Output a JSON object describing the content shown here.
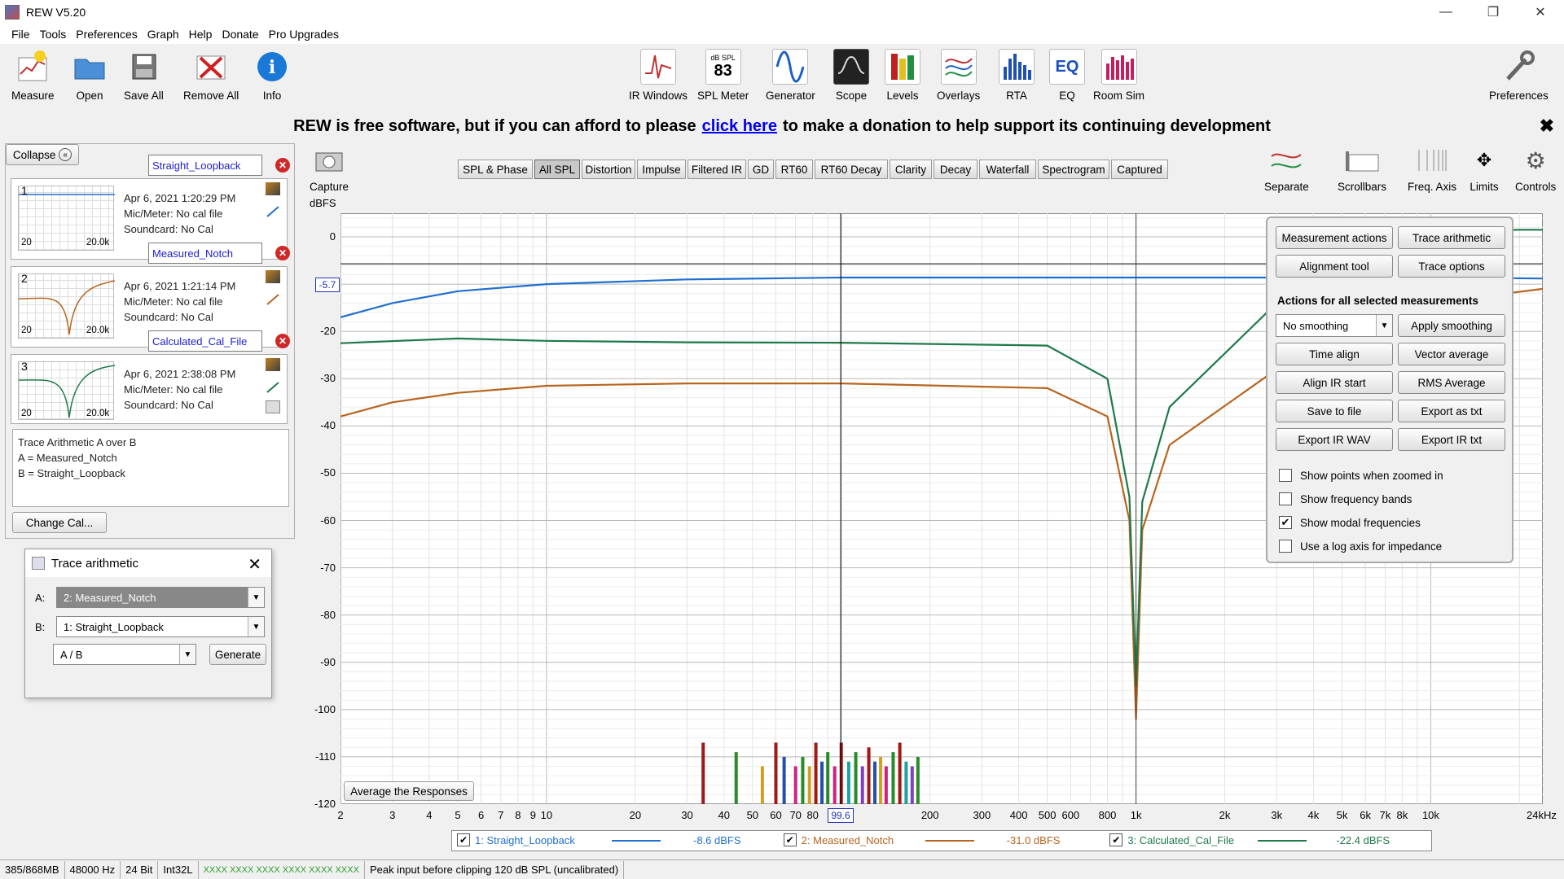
{
  "window": {
    "title": "REW V5.20"
  },
  "menu": [
    "File",
    "Tools",
    "Preferences",
    "Graph",
    "Help",
    "Donate",
    "Pro Upgrades"
  ],
  "toolbar": {
    "left": [
      "Measure",
      "Open",
      "Save All",
      "Remove All",
      "Info"
    ],
    "center": [
      "IR Windows",
      "SPL Meter",
      "Generator",
      "Scope",
      "Levels",
      "Overlays",
      "RTA",
      "EQ",
      "Room Sim"
    ],
    "right": "Preferences",
    "spl_badge_top": "dB SPL",
    "spl_badge_value": "83",
    "eq_badge": "EQ"
  },
  "banner": {
    "before": "REW is free software, but if you can afford to please",
    "link": "click here",
    "after": "to make a donation to help support its continuing development"
  },
  "left_panel": {
    "collapse": "Collapse",
    "measurements": [
      {
        "num": "1",
        "name": "Straight_Loopback",
        "date": "Apr 6, 2021 1:20:29 PM",
        "mic": "Mic/Meter: No cal file",
        "card": "Soundcard: No Cal",
        "tl_left": "20",
        "tl_right": "20.0k"
      },
      {
        "num": "2",
        "name": "Measured_Notch",
        "date": "Apr 6, 2021 1:21:14 PM",
        "mic": "Mic/Meter: No cal file",
        "card": "Soundcard: No Cal",
        "tl_left": "20",
        "tl_right": "20.0k"
      },
      {
        "num": "3",
        "name": "Calculated_Cal_File",
        "date": "Apr 6, 2021 2:38:08 PM",
        "mic": "Mic/Meter: No cal file",
        "card": "Soundcard: No Cal",
        "tl_left": "20",
        "tl_right": "20.0k"
      }
    ],
    "notes": [
      "Trace Arithmetic A over B",
      "A = Measured_Notch",
      "B = Straight_Loopback"
    ],
    "change_cal": "Change Cal..."
  },
  "trace_dialog": {
    "title": "Trace arithmetic",
    "a_label": "A:",
    "a_value": "2: Measured_Notch",
    "b_label": "B:",
    "b_value": "1: Straight_Loopback",
    "op_value": "A / B",
    "generate": "Generate"
  },
  "graph": {
    "capture": "Capture",
    "tabs": [
      "SPL & Phase",
      "All SPL",
      "Distortion",
      "Impulse",
      "Filtered IR",
      "GD",
      "RT60",
      "RT60 Decay",
      "Clarity",
      "Decay",
      "Waterfall",
      "Spectrogram",
      "Captured"
    ],
    "selected_tab": "All SPL",
    "right_icons": [
      "Separate",
      "Scrollbars",
      "Freq. Axis",
      "Limits",
      "Controls"
    ],
    "yunit": "dBFS",
    "cursor_y": "-5.7",
    "cursor_x": "99.6",
    "avg_button": "Average the Responses",
    "x_end_label": "24kHz"
  },
  "actions_panel": {
    "buttons_top": [
      "Measurement actions",
      "Trace arithmetic",
      "Alignment tool",
      "Trace options"
    ],
    "heading": "Actions for all selected measurements",
    "smoothing": "No  smoothing",
    "buttons": [
      "Apply smoothing",
      "Time align",
      "Vector average",
      "Align IR start",
      "RMS Average",
      "Save to file",
      "Export as txt",
      "Export IR WAV",
      "Export IR txt"
    ],
    "checkboxes": [
      {
        "label": "Show points when zoomed in",
        "checked": false
      },
      {
        "label": "Show frequency bands",
        "checked": false
      },
      {
        "label": "Show modal frequencies",
        "checked": true
      },
      {
        "label": "Use a log axis for impedance",
        "checked": false
      }
    ]
  },
  "legend": [
    {
      "name": "1: Straight_Loopback",
      "value": "-8.6 dBFS",
      "color": "#1f6fd0"
    },
    {
      "name": "2: Measured_Notch",
      "value": "-31.0 dBFS",
      "color": "#b8641e"
    },
    {
      "name": "3: Calculated_Cal_File",
      "value": "-22.4 dBFS",
      "color": "#1e7a4a"
    }
  ],
  "status": {
    "mem": "385/868MB",
    "rate": "48000 Hz",
    "bits": "24 Bit",
    "fmt": "Int32L",
    "meter": "XXXX XXXX  XXXX XXXX  XXXX XXXX",
    "msg": "Peak input before clipping 120 dB SPL (uncalibrated)"
  },
  "chart_data": {
    "type": "line",
    "ylabel": "dBFS",
    "ylim": [
      -120,
      5
    ],
    "xscale": "log",
    "xlim": [
      2,
      24000
    ],
    "y_ticks": [
      "0",
      "-10",
      "-20",
      "-30",
      "-40",
      "-50",
      "-60",
      "-70",
      "-80",
      "-90",
      "-100",
      "-110",
      "-120"
    ],
    "x_ticks": [
      "2",
      "3",
      "4",
      "5",
      "6",
      "7",
      "8",
      "9",
      "10",
      "20",
      "30",
      "40",
      "50",
      "60",
      "70",
      "80",
      "200",
      "300",
      "400",
      "500",
      "600",
      "800",
      "1k",
      "2k",
      "3k",
      "4k",
      "5k",
      "6k",
      "7k",
      "8k",
      "10k"
    ],
    "series": [
      {
        "name": "1: Straight_Loopback",
        "color": "#1f6fd0",
        "x": [
          2,
          3,
          5,
          10,
          30,
          100,
          1000,
          10000,
          24000
        ],
        "y": [
          -17,
          -14,
          -11.5,
          -10,
          -9,
          -8.6,
          -8.6,
          -8.6,
          -8.8
        ]
      },
      {
        "name": "2: Measured_Notch",
        "color": "#b8641e",
        "x": [
          2,
          3,
          5,
          10,
          30,
          100,
          500,
          800,
          950,
          1000,
          1050,
          1300,
          3000,
          10000,
          24000
        ],
        "y": [
          -38,
          -35,
          -33,
          -31.5,
          -31,
          -31,
          -32,
          -38,
          -60,
          -102,
          -62,
          -44,
          -28,
          -14,
          -11
        ]
      },
      {
        "name": "3: Calculated_Cal_File",
        "color": "#1e7a4a",
        "x": [
          2,
          5,
          10,
          30,
          100,
          500,
          800,
          950,
          1000,
          1050,
          1300,
          3000,
          10000,
          20000,
          24000
        ],
        "y": [
          -22.5,
          -21.5,
          -22,
          -22.3,
          -22.4,
          -23,
          -30,
          -55,
          -95,
          -56,
          -36,
          -14,
          1,
          1.5,
          1.5
        ]
      }
    ]
  }
}
